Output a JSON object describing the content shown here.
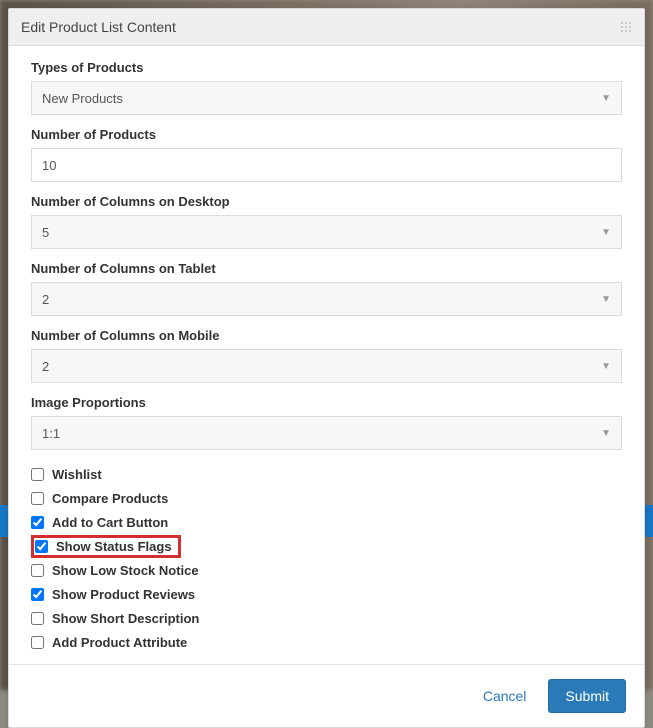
{
  "modal": {
    "title": "Edit Product List Content",
    "fields": {
      "types_label": "Types of Products",
      "types_value": "New Products",
      "num_products_label": "Number of Products",
      "num_products_value": "10",
      "cols_desktop_label": "Number of Columns on Desktop",
      "cols_desktop_value": "5",
      "cols_tablet_label": "Number of Columns on Tablet",
      "cols_tablet_value": "2",
      "cols_mobile_label": "Number of Columns on Mobile",
      "cols_mobile_value": "2",
      "img_prop_label": "Image Proportions",
      "img_prop_value": "1:1"
    },
    "checks": {
      "wishlist": "Wishlist",
      "compare": "Compare Products",
      "add_cart": "Add to Cart Button",
      "status_flags": "Show Status Flags",
      "low_stock": "Show Low Stock Notice",
      "reviews": "Show Product Reviews",
      "short_desc": "Show Short Description",
      "add_attr": "Add Product Attribute"
    },
    "footer": {
      "cancel": "Cancel",
      "submit": "Submit"
    }
  }
}
